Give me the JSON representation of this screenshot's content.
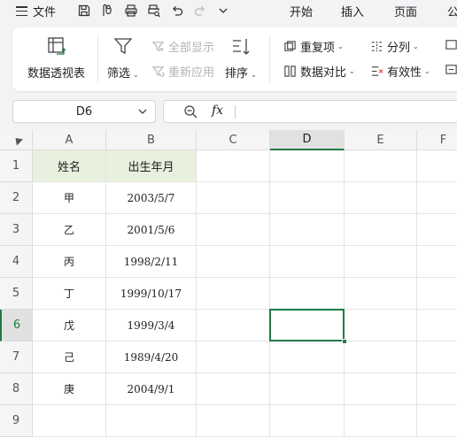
{
  "menubar": {
    "file_label": "文件",
    "tabs": [
      "开始",
      "插入",
      "页面",
      "公"
    ]
  },
  "ribbon": {
    "pivot_label": "数据透视表",
    "filter_label": "筛选",
    "show_all_label": "全部显示",
    "reapply_label": "重新应用",
    "sort_label": "排序",
    "duplicates_label": "重复项",
    "compare_label": "数据对比",
    "split_label": "分列",
    "validity_label": "有效性"
  },
  "formula_bar": {
    "cell_ref": "D6",
    "fx_label": "fx",
    "formula": ""
  },
  "sheet": {
    "columns": [
      "A",
      "B",
      "C",
      "D",
      "E",
      "F"
    ],
    "active_column": "D",
    "rows": [
      "1",
      "2",
      "3",
      "4",
      "5",
      "6",
      "7",
      "8",
      "9"
    ],
    "active_row": "6",
    "header_fill": "#e8f1de",
    "selection_color": "#1f7a43",
    "data": [
      [
        "姓名",
        "出生年月"
      ],
      [
        "甲",
        "2003/5/7"
      ],
      [
        "乙",
        "2001/5/6"
      ],
      [
        "丙",
        "1998/2/11"
      ],
      [
        "丁",
        "1999/10/17"
      ],
      [
        "戊",
        "1999/3/4"
      ],
      [
        "己",
        "1989/4/20"
      ],
      [
        "庚",
        "2004/9/1"
      ]
    ]
  }
}
